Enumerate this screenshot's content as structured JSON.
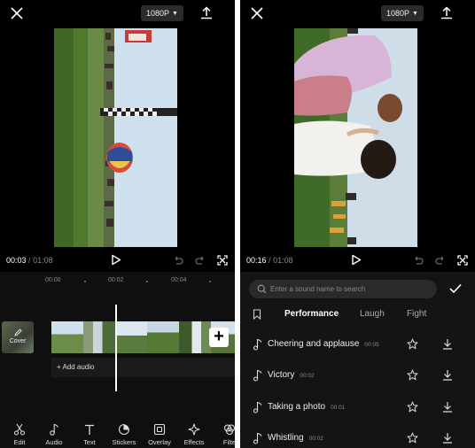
{
  "left": {
    "resolution": "1080P",
    "time_current": "00:03",
    "time_separator": "/",
    "time_total": "01:08",
    "ruler_ticks": [
      "00:00",
      "00:02",
      "00:04"
    ],
    "cover_label": "Cover",
    "add_audio_label": "+ Add audio",
    "toolbar": [
      {
        "label": "Edit",
        "icon": "scissors-icon"
      },
      {
        "label": "Audio",
        "icon": "music-note-icon"
      },
      {
        "label": "Text",
        "icon": "text-icon"
      },
      {
        "label": "Stickers",
        "icon": "sticker-icon"
      },
      {
        "label": "Overlay",
        "icon": "overlay-icon"
      },
      {
        "label": "Effects",
        "icon": "sparkle-icon"
      },
      {
        "label": "Filte",
        "icon": "filter-icon"
      }
    ]
  },
  "right": {
    "resolution": "1080P",
    "time_current": "00:16",
    "time_separator": "/",
    "time_total": "01:08",
    "search_placeholder": "Enter a sound name to search",
    "tabs": [
      {
        "label": "Performance",
        "active": true
      },
      {
        "label": "Laugh",
        "active": false
      },
      {
        "label": "Fight",
        "active": false
      }
    ],
    "sounds": [
      {
        "name": "Cheering and applause",
        "duration": "00:05"
      },
      {
        "name": "Victory",
        "duration": "00:02"
      },
      {
        "name": "Taking a photo",
        "duration": "00:01"
      },
      {
        "name": "Whistling",
        "duration": "00:02"
      }
    ]
  }
}
